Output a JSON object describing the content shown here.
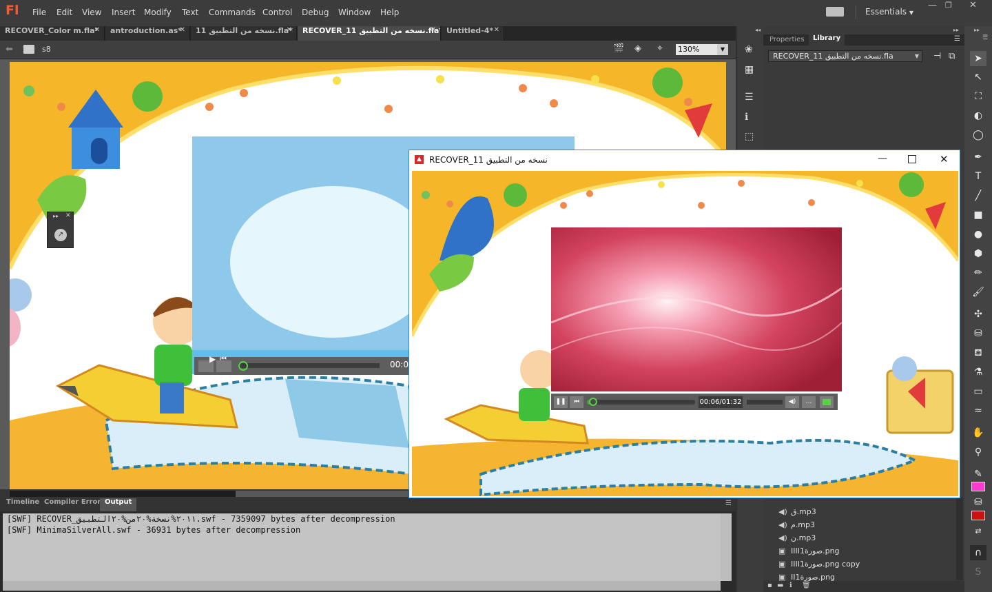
{
  "app": {
    "logo": "Fl"
  },
  "menu": [
    "File",
    "Edit",
    "View",
    "Insert",
    "Modify",
    "Text",
    "Commands",
    "Control",
    "Debug",
    "Window",
    "Help"
  ],
  "workspace": "Essentials",
  "doc_tabs": [
    {
      "label": "RECOVER_Color m.fla*",
      "active": false
    },
    {
      "label": "antroduction.as*",
      "active": false
    },
    {
      "label": "نسخه من التطبيق 11.fla*",
      "active": false
    },
    {
      "label": "RECOVER_11 نسخه من التطبيق.fla*",
      "active": true
    },
    {
      "label": "Untitled-4*",
      "active": false
    }
  ],
  "edit_bar": {
    "scene": "s8",
    "zoom": "130%"
  },
  "right_panel": {
    "tabs": [
      "Properties",
      "Library"
    ],
    "active_tab": "Library",
    "library_doc": "RECOVER_11 نسخه من التطبيق.fla",
    "items": [
      {
        "name": "ق.mp3",
        "type": "sound"
      },
      {
        "name": "م.mp3",
        "type": "sound"
      },
      {
        "name": "ن.mp3",
        "type": "sound"
      },
      {
        "name": "IIIIصورة1.png",
        "type": "bitmap"
      },
      {
        "name": "IIIIصورة1.png copy",
        "type": "bitmap"
      },
      {
        "name": "IIصورة1.png",
        "type": "bitmap"
      }
    ]
  },
  "bottom_panel": {
    "tabs": [
      "Timeline",
      "Compiler Errors",
      "Output"
    ],
    "active_tab": "Output",
    "lines": [
      "[SWF] RECOVER_٢٠١١%نسخة%٢٠من%٢٠التطبيق.swf - 7359097 bytes after decompression",
      "[SWF] MinimaSilverAll.swf - 36931 bytes after decompression"
    ]
  },
  "stage_video": {
    "time": "00:0"
  },
  "player_window": {
    "title": "RECOVER_11 نسخه من التطبيق",
    "time": "00:06/01:32",
    "progress": 0.06
  },
  "colors": {
    "accent": "#1e8cd4",
    "fill_color": "#ff3ad0",
    "stroke_color": "#cc1111",
    "logo": "#f25a3a"
  }
}
